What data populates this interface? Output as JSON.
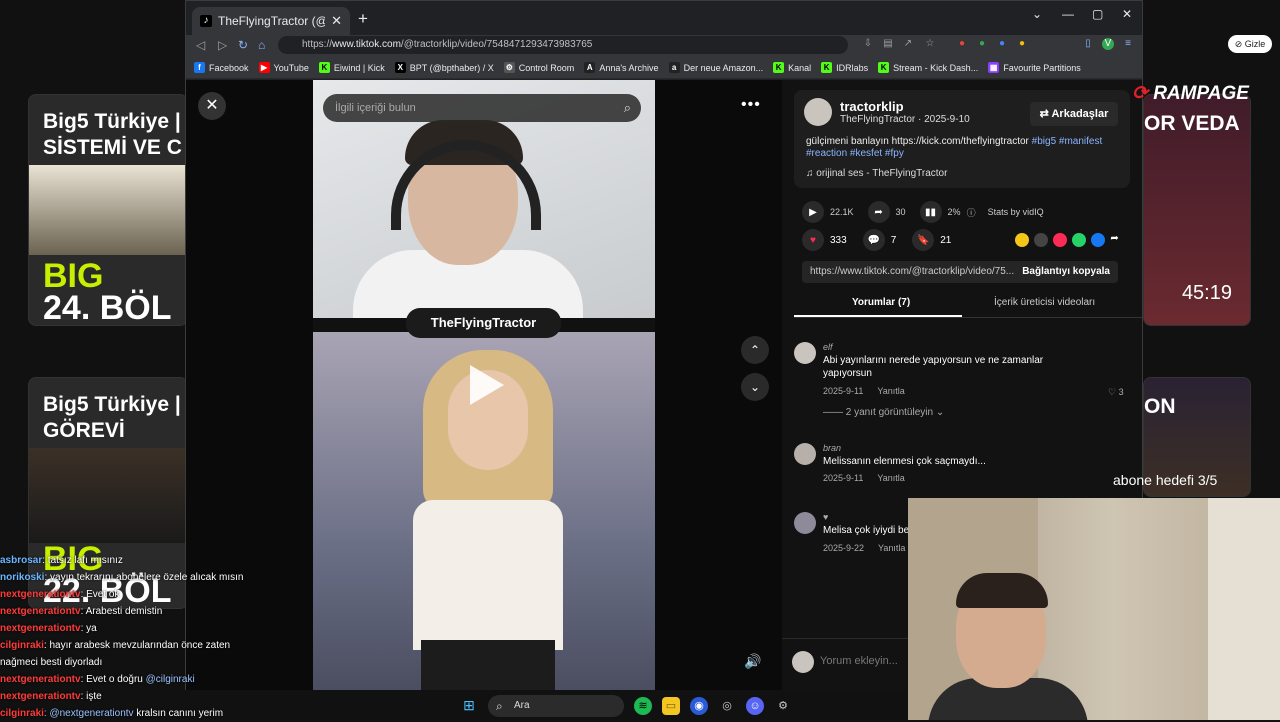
{
  "background": {
    "cards": [
      {
        "title_line1": "Big5 Türkiye |",
        "title_line2": "SİSTEMİ VE C",
        "big_line1": "BIG",
        "big_line2": "24. BÖL"
      },
      {
        "title_line1": "Big5 Türkiye |",
        "title_line2": "GÖREVİ",
        "big_line1": "BIG",
        "big_line2": "22. BÖL"
      }
    ],
    "right_cards": [
      {
        "title": "OR VEDA",
        "duration": "45:19"
      },
      {
        "title": "ON"
      }
    ]
  },
  "browser": {
    "tab_title": "TheFlyingTractor (@tractork",
    "tab_close": "✕",
    "new_tab": "+",
    "window_controls": [
      "⌄",
      "—",
      "▢",
      "✕"
    ],
    "url_prefix": "https://",
    "url_host": "www.tiktok.com",
    "url_path": "/@tractorklip/video/7548471293473983765",
    "bookmarks": [
      {
        "label": "Facebook",
        "icon": "facebook-icon",
        "color": "#1877f2",
        "glyph": "f"
      },
      {
        "label": "YouTube",
        "icon": "youtube-icon",
        "color": "#ff0000",
        "glyph": "▶"
      },
      {
        "label": "Eiwind | Kick",
        "icon": "kick-icon",
        "color": "#53fc18",
        "glyph": "K"
      },
      {
        "label": "BPT (@bpthaber) / X",
        "icon": "x-icon",
        "color": "#000000",
        "glyph": "X"
      },
      {
        "label": "Control Room",
        "icon": "gear-icon",
        "color": "#555555",
        "glyph": "⚙"
      },
      {
        "label": "Anna's Archive",
        "icon": "archive-icon",
        "color": "#222222",
        "glyph": "A"
      },
      {
        "label": "Der neue Amazon...",
        "icon": "amazon-icon",
        "color": "#222222",
        "glyph": "a"
      },
      {
        "label": "Kanal",
        "icon": "kick-icon",
        "color": "#53fc18",
        "glyph": "K"
      },
      {
        "label": "IDRlabs",
        "icon": "kick-icon",
        "color": "#53fc18",
        "glyph": "K"
      },
      {
        "label": "Stream - Kick Dash...",
        "icon": "kick-icon",
        "color": "#53fc18",
        "glyph": "K"
      },
      {
        "label": "Favourite Partitions",
        "icon": "partition-icon",
        "color": "#8a3ffc",
        "glyph": "▦"
      }
    ]
  },
  "tiktok": {
    "search_placeholder": "İlgili içeriği bulun",
    "close": "✕",
    "more": "•••",
    "up": "⌃",
    "down": "⌄",
    "volume": "🔊",
    "video_nametag": "TheFlyingTractor",
    "author": {
      "handle": "tractorklip",
      "name": "TheFlyingTractor",
      "date": "2025-9-10"
    },
    "follow_label": "⇄ Arkadaşlar",
    "caption_text": "gülçimeni banlayın https://kick.com/theflyingtractor",
    "caption_tags": "#big5 #manifest",
    "caption_tags_line2": "#reaction #kesfet #fpy",
    "music": "♫  orijinal ses - TheFlyingTractor",
    "stats": {
      "plays": "22.1K",
      "shares": "30",
      "percent": "2%",
      "vidiq": "Stats by vidIQ"
    },
    "likes": "333",
    "comments_count": "7",
    "saves": "21",
    "link": "https://www.tiktok.com/@tractorklip/video/75...",
    "copy_link": "Bağlantıyı kopyala",
    "tab_comments": "Yorumlar (7)",
    "tab_creator_videos": "İçerik üreticisi videoları",
    "comments": [
      {
        "user": "elf",
        "text": "Abi yayınlarını nerede yapıyorsun ve ne zamanlar yapıyorsun",
        "date": "2025-9-11",
        "reply": "Yanıtla"
      },
      {
        "user": "bran",
        "text": "Melissanın elenmesi çok saçmaydı...",
        "date": "2025-9-11",
        "reply": "Yanıtla"
      },
      {
        "user": "♥",
        "text": "Melisa çok iyiydi be",
        "date": "2025-9-22",
        "reply": "Yanıtla"
      }
    ],
    "view_replies": "—— 2 yanıt görüntüleyin ⌄",
    "elf_likes": "♡ 3",
    "comment_placeholder": "Yorum ekleyin..."
  },
  "overlay": {
    "gizle": "Gizle",
    "rampage": "RAMPAGE",
    "abone": "abone hedefi 3/5"
  },
  "chat": [
    {
      "user": "asbrosar",
      "msg": ": tatsız lafı mısınız"
    },
    {
      "user": "norikoski",
      "msg": ": yayın tekrarını abonelere özele alıcak mısın"
    },
    {
      "user": "nextgenerationtv",
      "msg": ": Evet ok"
    },
    {
      "user": "nextgenerationtv",
      "msg": ": Arabesti demistin"
    },
    {
      "user": "nextgenerationtv",
      "msg": ": ya"
    },
    {
      "user": "cilginraki",
      "msg": ": hayır arabesk mevzularından önce zaten"
    },
    {
      "user": "",
      "msg": "nağmeci besti diyorladı"
    },
    {
      "user": "nextgenerationtv",
      "msg": ": Evet o doğru",
      "mention": " @cilginraki"
    },
    {
      "user": "nextgenerationtv",
      "msg": ": işte"
    },
    {
      "user": "cilginraki",
      "msg": " kralsın canını yerim",
      "mention": ": @nextgenerationtv"
    }
  ],
  "taskbar": {
    "search": "Ara"
  }
}
